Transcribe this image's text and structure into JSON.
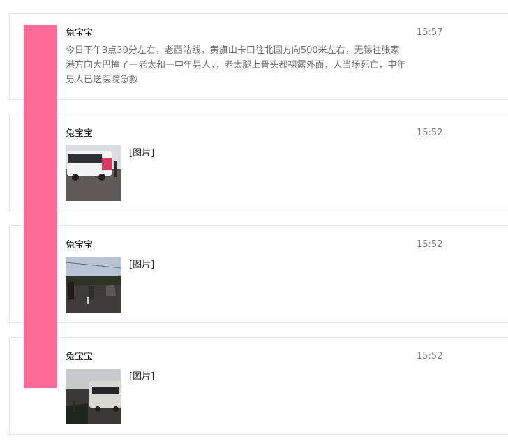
{
  "colors": {
    "avatar_band": "#ff6b95",
    "card_border": "#e6e6e6",
    "body_text": "#6f6f6f",
    "sender_text": "#222222",
    "time_text": "#7a7a7a"
  },
  "messages": [
    {
      "sender": "兔宝宝",
      "time": "15:57",
      "text": "今日下午3点30分左右，老西站线，黄旗山卡口往北国方向500米左右，无锡往张家港方向大巴撞了一老太和一中年男人，，老太腿上骨头都裸露外面，人当场死亡，中年男人已送医院急救"
    },
    {
      "sender": "兔宝宝",
      "time": "15:52",
      "image_label": "[图片]",
      "thumbnail_icon": "bus-photo"
    },
    {
      "sender": "兔宝宝",
      "time": "15:52",
      "image_label": "[图片]",
      "thumbnail_icon": "street-photo"
    },
    {
      "sender": "兔宝宝",
      "time": "15:52",
      "image_label": "[图片]",
      "thumbnail_icon": "bus-dusk-photo"
    }
  ]
}
